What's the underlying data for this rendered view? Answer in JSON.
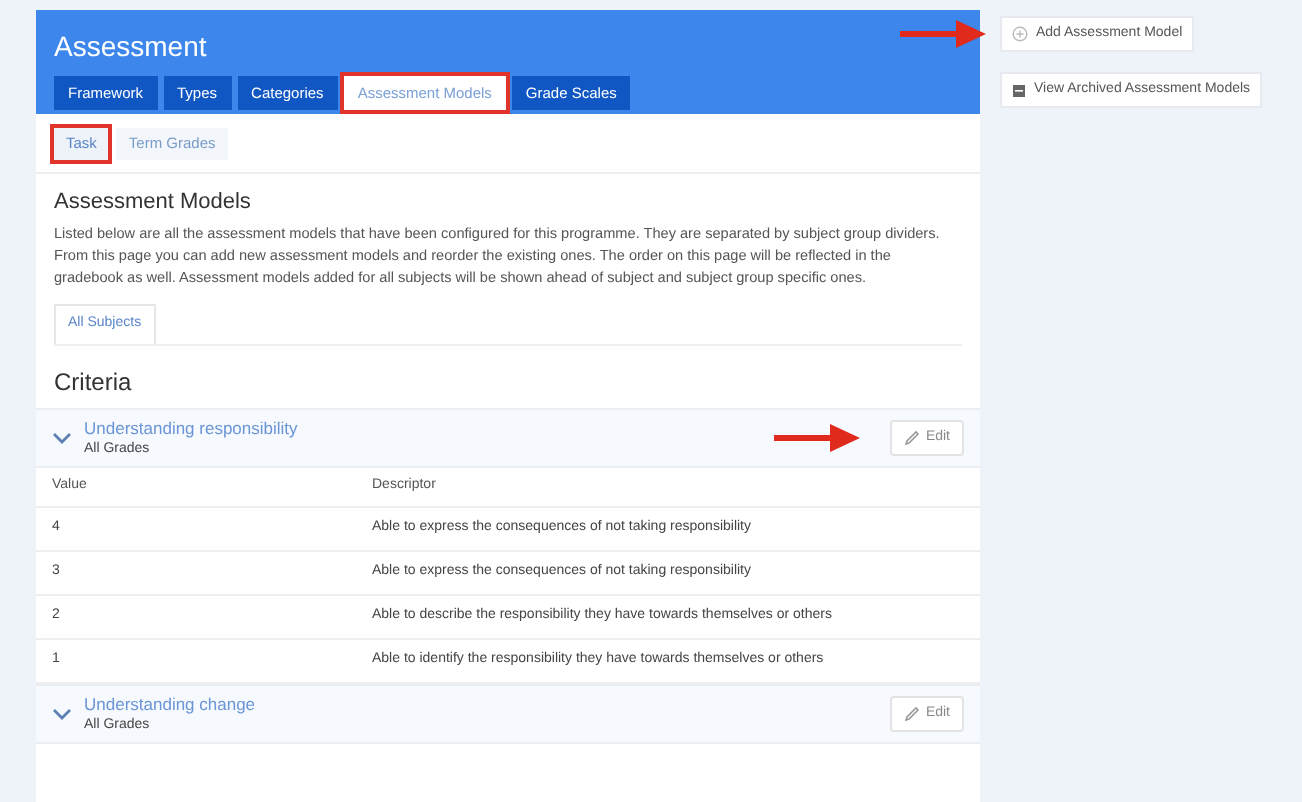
{
  "header": {
    "title": "Assessment"
  },
  "tabs": [
    {
      "label": "Framework",
      "selected": false,
      "highlighted": false
    },
    {
      "label": "Types",
      "selected": false,
      "highlighted": false
    },
    {
      "label": "Categories",
      "selected": false,
      "highlighted": false
    },
    {
      "label": "Assessment Models",
      "selected": true,
      "highlighted": true
    },
    {
      "label": "Grade Scales",
      "selected": false,
      "highlighted": false
    }
  ],
  "subtabs": [
    {
      "label": "Task",
      "selected": true,
      "highlighted": true
    },
    {
      "label": "Term Grades",
      "selected": false,
      "highlighted": false
    }
  ],
  "section": {
    "title": "Assessment Models",
    "description": "Listed below are all the assessment models that have been configured for this programme. They are separated by subject group dividers. From this page you can add new assessment models and reorder the existing ones. The order on this page will be reflected in the gradebook as well. Assessment models added for all subjects will be shown ahead of subject and subject group specific ones."
  },
  "subject_tabs": [
    {
      "label": "All Subjects",
      "selected": true
    }
  ],
  "criteria_title": "Criteria",
  "criteria": [
    {
      "name": "Understanding responsibility",
      "grades": "All Grades",
      "edit_label": "Edit",
      "arrow": true,
      "table": {
        "columns": [
          "Value",
          "Descriptor"
        ],
        "rows": [
          [
            "4",
            "Able to express the consequences of not taking responsibility"
          ],
          [
            "3",
            "Able to express the consequences of not taking responsibility"
          ],
          [
            "2",
            "Able to describe the responsibility they have towards themselves or others"
          ],
          [
            "1",
            "Able to identify the responsibility they have towards themselves or others"
          ]
        ]
      }
    },
    {
      "name": "Understanding change",
      "grades": "All Grades",
      "edit_label": "Edit",
      "arrow": false
    }
  ],
  "sidebar": {
    "buttons": [
      {
        "kind": "add",
        "label": "Add Assessment Model",
        "arrow": true
      },
      {
        "kind": "archive",
        "label": "View Archived Assessment Models",
        "arrow": false
      }
    ]
  }
}
